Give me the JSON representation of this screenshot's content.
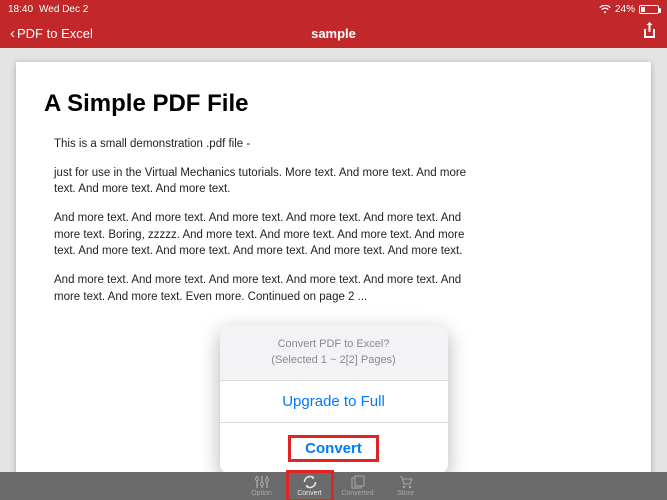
{
  "statusbar": {
    "time": "18:40",
    "date": "Wed Dec 2",
    "battery": "24%"
  },
  "nav": {
    "back_label": "PDF to Excel",
    "title": "sample"
  },
  "doc": {
    "heading": "A Simple PDF File",
    "p1": "This is a small demonstration .pdf file -",
    "p2": "just for use in the Virtual Mechanics tutorials. More text. And more text. And more text. And more text. And more text.",
    "p3": "And more text. And more text. And more text. And more text. And more text. And more text. Boring, zzzzz. And more text. And more text. And more text. And more text. And more text. And more text. And more text. And more text. And more text.",
    "p4": "And more text. And more text. And more text. And more text. And more text. And more text. And more text. Even more. Continued on page 2 ..."
  },
  "popup": {
    "line1": "Convert PDF to Excel?",
    "line2": "(Selected 1 ~ 2[2] Pages)",
    "upgrade": "Upgrade to Full",
    "convert": "Convert"
  },
  "tabs": {
    "option": "Option",
    "convert": "Convert",
    "converted": "Converted",
    "store": "Store"
  }
}
